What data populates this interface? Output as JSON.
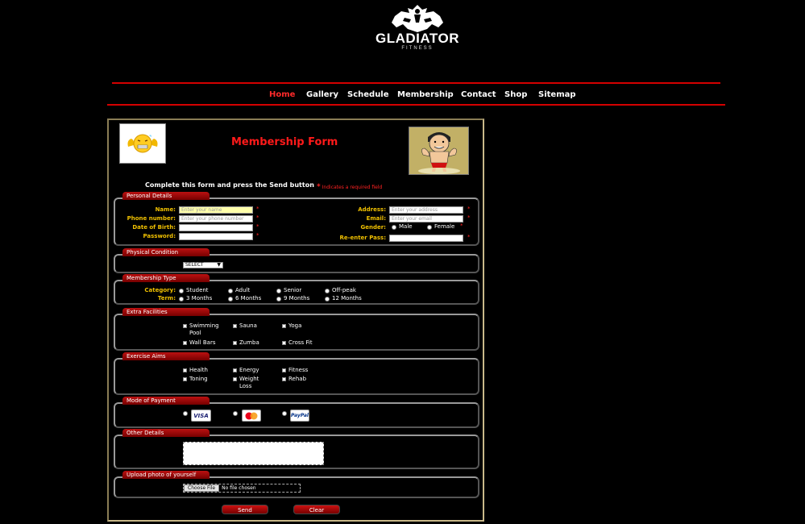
{
  "brand": {
    "name": "GLADIATOR",
    "tagline": "FITNESS"
  },
  "nav": [
    {
      "label": "Home",
      "active": true
    },
    {
      "label": "Gallery",
      "active": false
    },
    {
      "label": "Schedule",
      "active": false
    },
    {
      "label": "Membership",
      "active": false
    },
    {
      "label": "Contact",
      "active": false
    },
    {
      "label": "Shop",
      "active": false
    },
    {
      "label": "Sitemap",
      "active": false
    }
  ],
  "form": {
    "title": "Membership Form",
    "instruction": "Complete this form and press the Send button",
    "required_note_star": "*",
    "required_note": "Indicates a required field",
    "star": "*",
    "personal": {
      "legend": "Personal Details",
      "name_label": "Name:",
      "name_placeholder": "Enter your name",
      "phone_label": "Phone number:",
      "phone_placeholder": "Enter your phone number",
      "dob_label": "Date of Birth:",
      "password_label": "Password:",
      "address_label": "Address:",
      "address_placeholder": "Enter your address",
      "email_label": "Email:",
      "email_placeholder": "Enter your email",
      "gender_label": "Gender:",
      "gender_options": [
        "Male",
        "Female"
      ],
      "reenter_label": "Re-enter Pass:"
    },
    "physical": {
      "legend": "Physical Condition",
      "select_value": "SELECT"
    },
    "membership": {
      "legend": "Membership Type",
      "category_label": "Category:",
      "categories": [
        "Student",
        "Adult",
        "Senior",
        "Off-peak"
      ],
      "term_label": "Term:",
      "terms": [
        "3 Months",
        "6 Months",
        "9 Months",
        "12 Months"
      ]
    },
    "facilities": {
      "legend": "Extra Facilities",
      "row1": [
        "Swimming",
        "Sauna",
        "Yoga"
      ],
      "row1_extra": "Pool",
      "row2": [
        "Wall Bars",
        "Zumba",
        "Cross Fit"
      ]
    },
    "aims": {
      "legend": "Exercise Aims",
      "row1": [
        "Health",
        "Energy",
        "Fitness"
      ],
      "row2": [
        "Toning",
        "Weight",
        "Rehab"
      ],
      "row2_extra": "Loss"
    },
    "payment": {
      "legend": "Mode of Payment",
      "options": [
        "VISA",
        "MasterCard",
        "PayPal"
      ]
    },
    "other": {
      "legend": "Other Details"
    },
    "upload": {
      "legend": "Upload photo of yourself",
      "button": "Choose File",
      "status": "No file chosen"
    },
    "send_label": "Send",
    "clear_label": "Clear"
  },
  "colors": {
    "accent": "#ff1a1a",
    "label": "#f0c000",
    "legend_bg": "#a00000"
  }
}
